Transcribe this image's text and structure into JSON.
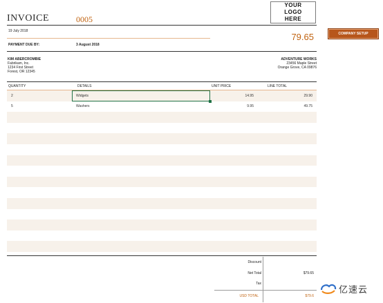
{
  "invoice": {
    "title": "INVOICE",
    "number": "0005",
    "date": "19 July 2018",
    "total": "79.65",
    "payment_due_label": "PAYMENT DUE BY:",
    "payment_due_value": "3 August 2018"
  },
  "logo": {
    "line1": "YOUR LOGO",
    "line2": "HERE"
  },
  "company_setup_label": "COMPANY SETUP",
  "bill_to": {
    "name": "KIM ABERCROMBIE",
    "line1": "Fabrikam, Inc.",
    "line2": "1234 First Street",
    "line3": "Forest, OR 12345"
  },
  "from": {
    "name": "ADVENTURE WORKS",
    "line1": "23456 Maple Street",
    "line2": "Orange Grove, CA 09876"
  },
  "table": {
    "headers": {
      "quantity": "QUANTITY",
      "details": "DETAILS",
      "unit_price": "UNIT PRICE",
      "line_total": "LINE TOTAL"
    },
    "rows": [
      {
        "quantity": "2",
        "details": "Widgets",
        "unit_price": "14.95",
        "line_total": "29.90"
      },
      {
        "quantity": "5",
        "details": "Washers",
        "unit_price": "9.95",
        "line_total": "49.75"
      }
    ]
  },
  "summary": {
    "discount_label": "Discount",
    "net_total_label": "Net Total",
    "net_total_value": "$79.65",
    "tax_label": "Tax",
    "usd_total_label": "USD TOTAL",
    "usd_total_value": "$79.6"
  },
  "watermark": {
    "text": "亿速云",
    "icon": "cloud-swirl-logo-icon"
  },
  "colors": {
    "accent": "#c0620f",
    "button": "#b7561b",
    "row_shade": "#f7f1ea",
    "selection": "#1f7145"
  }
}
